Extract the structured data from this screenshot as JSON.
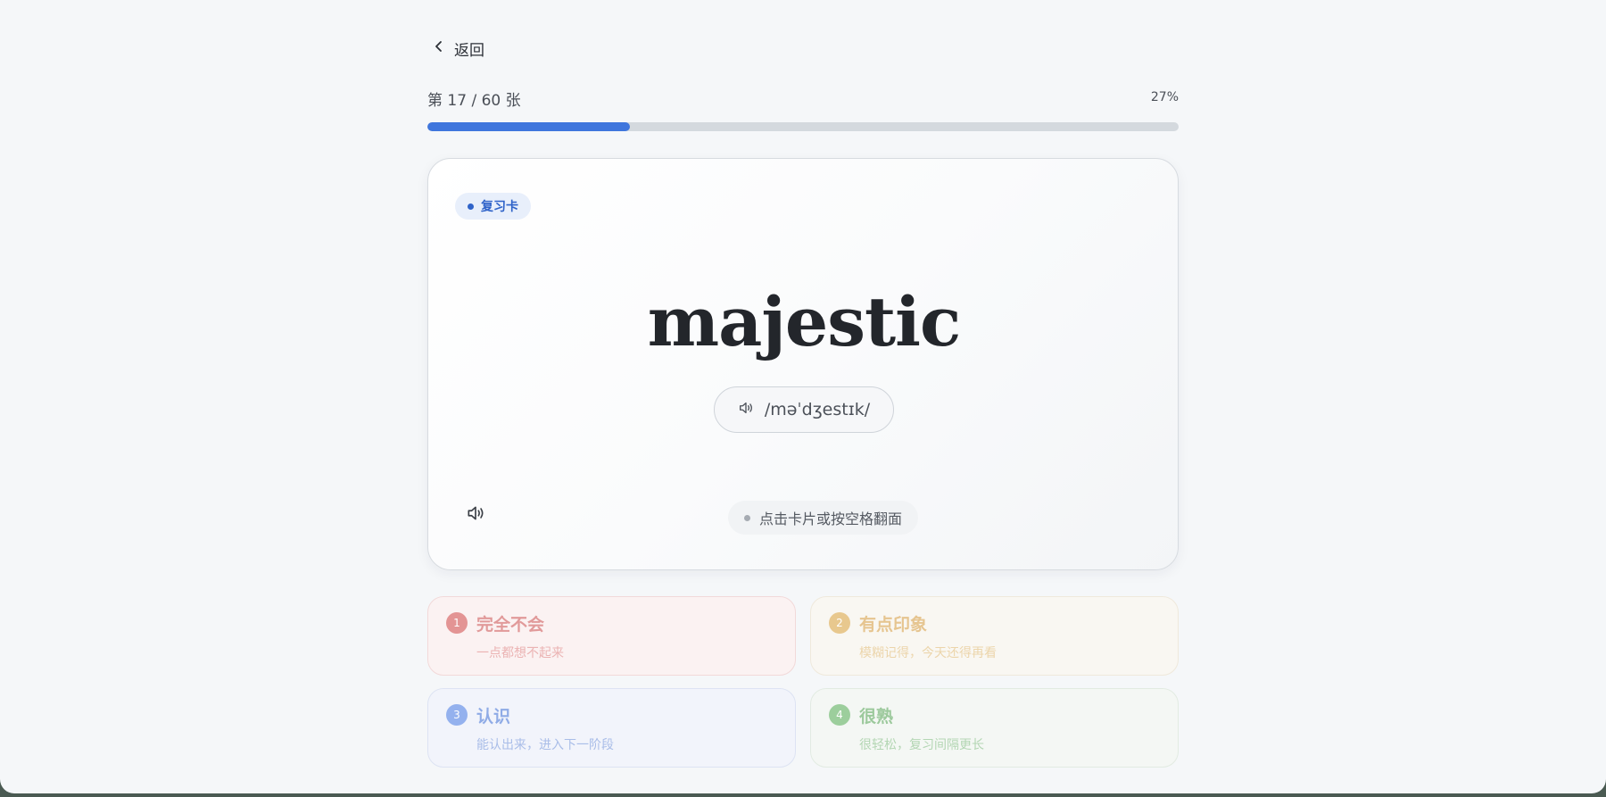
{
  "nav": {
    "back_label": "返回"
  },
  "progress": {
    "label": "第 17 / 60 张",
    "percent_label": "27%",
    "fraction": 0.27,
    "current": 17,
    "total": 60
  },
  "card": {
    "badge": "复习卡",
    "word": "majestic",
    "phonetic": "/məˈdʒestɪk/",
    "hint": "点击卡片或按空格翻面"
  },
  "ratings": [
    {
      "num": "1",
      "title": "完全不会",
      "desc": "一点都想不起来"
    },
    {
      "num": "2",
      "title": "有点印象",
      "desc": "模糊记得，今天还得再看"
    },
    {
      "num": "3",
      "title": "认识",
      "desc": "能认出来，进入下一阶段"
    },
    {
      "num": "4",
      "title": "很熟",
      "desc": "很轻松，复习间隔更长"
    }
  ],
  "colors": {
    "accent": "#3f76dd",
    "track": "#d4d9de",
    "again": "#e39494",
    "hard": "#e8c88e",
    "good": "#94b1ee",
    "easy": "#9cce9c"
  },
  "icons": {
    "back": "chevron-left-icon",
    "audio": "speaker-icon"
  }
}
